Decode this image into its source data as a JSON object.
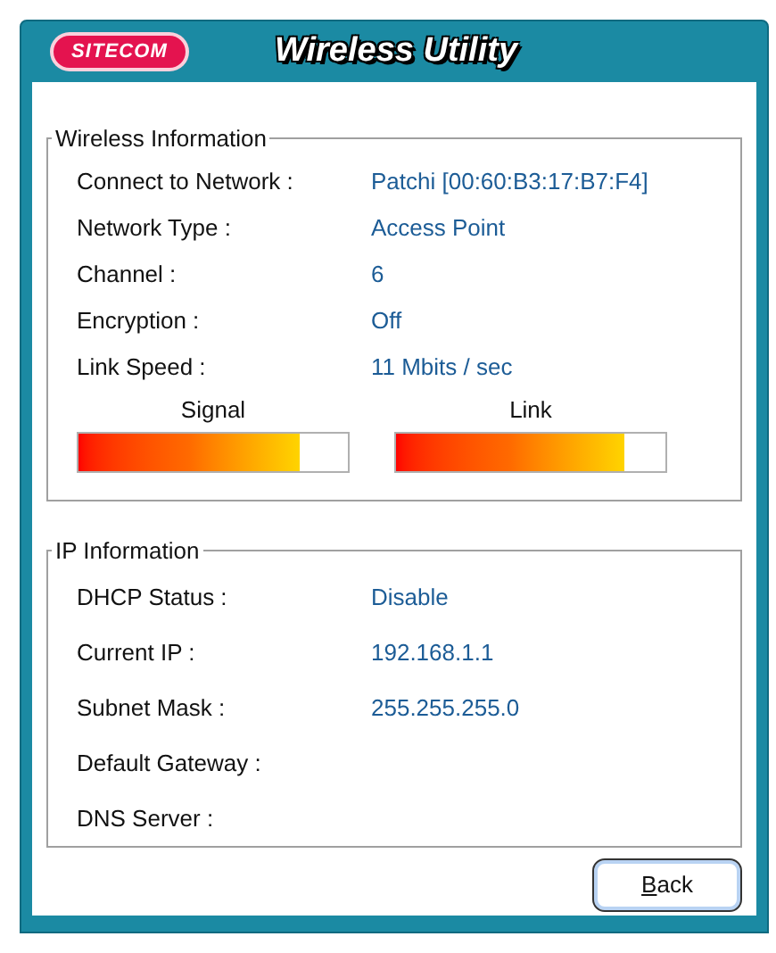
{
  "window": {
    "brand": "SITECOM",
    "title": "Wireless Utility"
  },
  "wireless_information": {
    "legend": "Wireless Information",
    "rows": [
      {
        "label": "Connect to Network :",
        "value": "Patchi [00:60:B3:17:B7:F4]"
      },
      {
        "label": "Network Type :",
        "value": "Access Point"
      },
      {
        "label": "Channel :",
        "value": "6"
      },
      {
        "label": "Encryption :",
        "value": "Off"
      },
      {
        "label": "Link Speed :",
        "value": "11 Mbits / sec"
      }
    ],
    "meters": [
      {
        "label": "Signal",
        "level": 0.82
      },
      {
        "label": "Link",
        "level": 0.85
      }
    ]
  },
  "ip_information": {
    "legend": "IP Information",
    "rows": [
      {
        "label": "DHCP Status :",
        "value": "Disable"
      },
      {
        "label": "Current IP :",
        "value": "192.168.1.1"
      },
      {
        "label": "Subnet Mask :",
        "value": "255.255.255.0"
      },
      {
        "label": "Default Gateway :"
      },
      {
        "label": "DNS Server :"
      }
    ]
  },
  "buttons": [
    {
      "label": "Back",
      "accelerator_underlined": true
    }
  ]
}
